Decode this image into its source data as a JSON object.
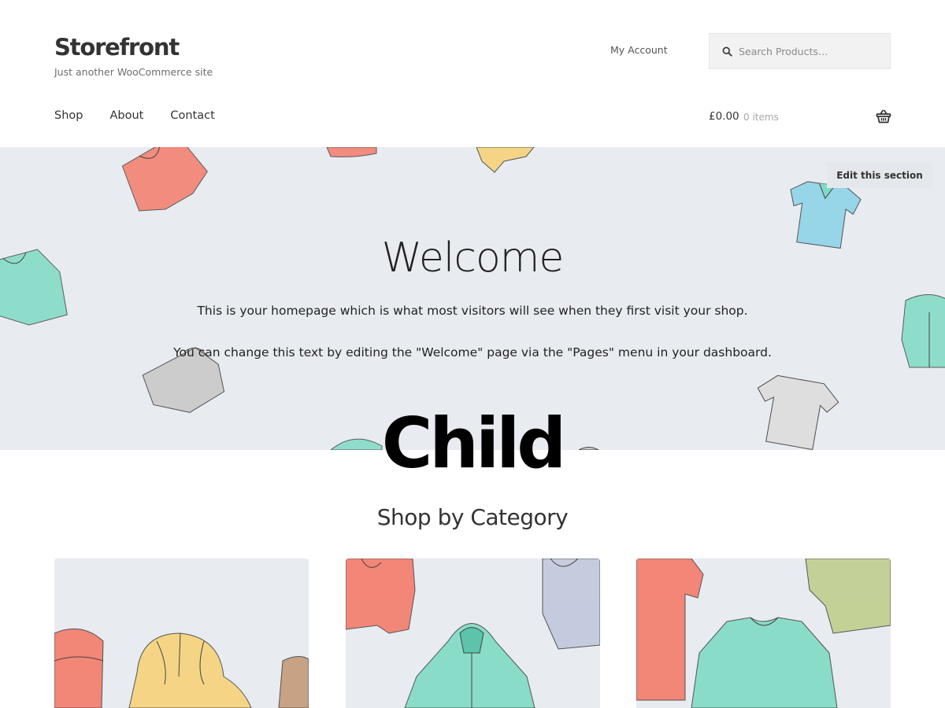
{
  "header": {
    "site_title": "Storefront",
    "tagline": "Just another WooCommerce site",
    "my_account": "My Account",
    "search_placeholder": "Search Products…",
    "search_icon": "search-icon"
  },
  "nav": {
    "items": [
      {
        "label": "Shop"
      },
      {
        "label": "About"
      },
      {
        "label": "Contact"
      }
    ]
  },
  "cart": {
    "total": "£0.00",
    "count": "0 items",
    "icon": "basket-icon"
  },
  "hero": {
    "edit_label": "Edit this section",
    "title": "Welcome",
    "line1": "This is your homepage which is what most visitors will see when they first visit your shop.",
    "line2": "You can change this text by editing the \"Welcome\" page via the \"Pages\" menu in your dashboard.",
    "background": "#e8ecf1"
  },
  "overlay_text": "Child",
  "section": {
    "title": "Shop by Category"
  },
  "colors": {
    "text": "#333333",
    "muted": "#6d6d6d",
    "hero_bg": "#e8ecf1",
    "coral": "#f47c6a",
    "mint": "#7fdbc4",
    "yellow": "#f7d37a",
    "sky": "#8fd3e8",
    "grey": "#c9c9c9",
    "olive": "#bfcf8e"
  }
}
